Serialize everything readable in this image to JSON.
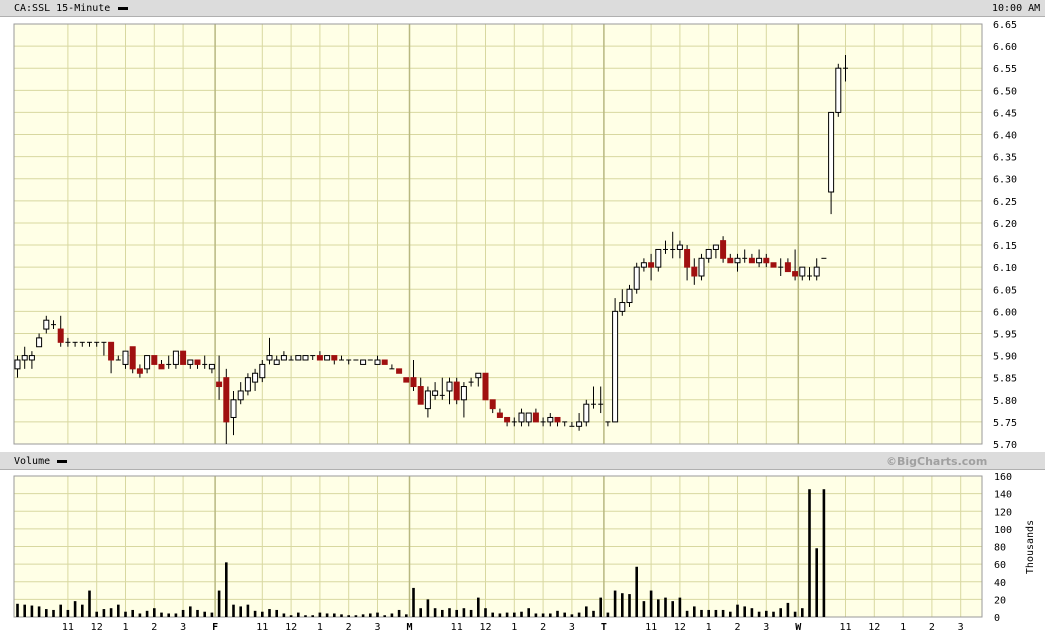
{
  "header": {
    "symbol_label": "CA:SSL 15-Minute",
    "time_label": "10:00 AM"
  },
  "volume_header": {
    "label": "Volume",
    "credit": "©BigCharts.com"
  },
  "colors": {
    "background": "#ffffe6",
    "grid": "#d8d8a0",
    "up": "#ffffff",
    "down": "#a01010",
    "outline": "#000000",
    "header_bg": "#dcdcdc"
  },
  "chart_data": [
    {
      "type": "candlestick",
      "name": "price",
      "ylim": [
        5.7,
        6.65
      ],
      "y_ticks": [
        "5.70",
        "5.75",
        "5.80",
        "5.85",
        "5.90",
        "5.95",
        "6.00",
        "6.05",
        "6.10",
        "6.15",
        "6.20",
        "6.25",
        "6.30",
        "6.35",
        "6.40",
        "6.45",
        "6.50",
        "6.55",
        "6.60",
        "6.65"
      ],
      "x_ticks": [
        {
          "label": "11",
          "bar": 7
        },
        {
          "label": "12",
          "bar": 11
        },
        {
          "label": "1",
          "bar": 15
        },
        {
          "label": "2",
          "bar": 19
        },
        {
          "label": "3",
          "bar": 23
        },
        {
          "label": "F",
          "bar": 28
        },
        {
          "label": "11",
          "bar": 34
        },
        {
          "label": "12",
          "bar": 38
        },
        {
          "label": "1",
          "bar": 42
        },
        {
          "label": "2",
          "bar": 46
        },
        {
          "label": "3",
          "bar": 50
        },
        {
          "label": "M",
          "bar": 55
        },
        {
          "label": "11",
          "bar": 61
        },
        {
          "label": "12",
          "bar": 65
        },
        {
          "label": "1",
          "bar": 69
        },
        {
          "label": "2",
          "bar": 73
        },
        {
          "label": "3",
          "bar": 77
        },
        {
          "label": "T",
          "bar": 82
        },
        {
          "label": "11",
          "bar": 88
        },
        {
          "label": "12",
          "bar": 92
        },
        {
          "label": "1",
          "bar": 96
        },
        {
          "label": "2",
          "bar": 100
        },
        {
          "label": "3",
          "bar": 104
        },
        {
          "label": "W",
          "bar": 109
        },
        {
          "label": "11",
          "bar": 115
        },
        {
          "label": "12",
          "bar": 119
        },
        {
          "label": "1",
          "bar": 123
        },
        {
          "label": "2",
          "bar": 127
        },
        {
          "label": "3",
          "bar": 131
        }
      ],
      "day_start_bars": [
        1,
        28,
        55,
        82,
        109
      ],
      "bars": [
        [
          5.87,
          5.9,
          5.85,
          5.89
        ],
        [
          5.89,
          5.92,
          5.87,
          5.9
        ],
        [
          5.89,
          5.91,
          5.87,
          5.9
        ],
        [
          5.92,
          5.95,
          5.92,
          5.94
        ],
        [
          5.96,
          5.99,
          5.95,
          5.98
        ],
        [
          5.97,
          5.98,
          5.96,
          5.97
        ],
        [
          5.96,
          5.99,
          5.92,
          5.93
        ],
        [
          5.93,
          5.94,
          5.92,
          5.93
        ],
        [
          5.93,
          5.93,
          5.92,
          5.93
        ],
        [
          5.93,
          5.93,
          5.92,
          5.93
        ],
        [
          5.93,
          5.93,
          5.92,
          5.93
        ],
        [
          5.93,
          5.93,
          5.92,
          5.93
        ],
        [
          5.93,
          5.93,
          5.9,
          5.93
        ],
        [
          5.93,
          5.93,
          5.86,
          5.89
        ],
        [
          5.89,
          5.9,
          5.89,
          5.89
        ],
        [
          5.88,
          5.91,
          5.87,
          5.91
        ],
        [
          5.92,
          5.92,
          5.86,
          5.87
        ],
        [
          5.87,
          5.88,
          5.85,
          5.86
        ],
        [
          5.87,
          5.9,
          5.86,
          5.9
        ],
        [
          5.9,
          5.9,
          5.88,
          5.88
        ],
        [
          5.88,
          5.89,
          5.87,
          5.87
        ],
        [
          5.88,
          5.9,
          5.87,
          5.88
        ],
        [
          5.88,
          5.91,
          5.87,
          5.91
        ],
        [
          5.91,
          5.91,
          5.88,
          5.88
        ],
        [
          5.88,
          5.89,
          5.87,
          5.89
        ],
        [
          5.89,
          5.89,
          5.87,
          5.88
        ],
        [
          5.88,
          5.9,
          5.87,
          5.88
        ],
        [
          5.87,
          5.88,
          5.86,
          5.88
        ],
        [
          5.84,
          5.9,
          5.8,
          5.83
        ],
        [
          5.85,
          5.87,
          5.7,
          5.75
        ],
        [
          5.76,
          5.82,
          5.72,
          5.8
        ],
        [
          5.8,
          5.84,
          5.79,
          5.82
        ],
        [
          5.82,
          5.86,
          5.81,
          5.85
        ],
        [
          5.84,
          5.87,
          5.82,
          5.86
        ],
        [
          5.85,
          5.89,
          5.84,
          5.88
        ],
        [
          5.89,
          5.94,
          5.88,
          5.9
        ],
        [
          5.88,
          5.9,
          5.88,
          5.89
        ],
        [
          5.89,
          5.91,
          5.89,
          5.9
        ],
        [
          5.89,
          5.9,
          5.89,
          5.89
        ],
        [
          5.89,
          5.9,
          5.89,
          5.9
        ],
        [
          5.89,
          5.9,
          5.89,
          5.9
        ],
        [
          5.9,
          5.9,
          5.89,
          5.9
        ],
        [
          5.9,
          5.91,
          5.89,
          5.89
        ],
        [
          5.89,
          5.9,
          5.89,
          5.9
        ],
        [
          5.9,
          5.9,
          5.88,
          5.89
        ],
        [
          5.89,
          5.9,
          5.89,
          5.89
        ],
        [
          5.89,
          5.89,
          5.88,
          5.89
        ],
        [
          5.89,
          5.89,
          5.89,
          5.89
        ],
        [
          5.88,
          5.89,
          5.88,
          5.89
        ],
        [
          5.89,
          5.89,
          5.89,
          5.89
        ],
        [
          5.88,
          5.9,
          5.88,
          5.89
        ],
        [
          5.89,
          5.89,
          5.88,
          5.88
        ],
        [
          5.87,
          5.88,
          5.87,
          5.87
        ],
        [
          5.87,
          5.87,
          5.86,
          5.86
        ],
        [
          5.85,
          5.85,
          5.84,
          5.84
        ],
        [
          5.85,
          5.89,
          5.82,
          5.83
        ],
        [
          5.83,
          5.85,
          5.79,
          5.79
        ],
        [
          5.78,
          5.83,
          5.76,
          5.82
        ],
        [
          5.81,
          5.84,
          5.8,
          5.82
        ],
        [
          5.81,
          5.85,
          5.8,
          5.81
        ],
        [
          5.82,
          5.85,
          5.79,
          5.84
        ],
        [
          5.84,
          5.85,
          5.79,
          5.8
        ],
        [
          5.8,
          5.84,
          5.76,
          5.83
        ],
        [
          5.84,
          5.85,
          5.83,
          5.84
        ],
        [
          5.85,
          5.86,
          5.83,
          5.86
        ],
        [
          5.86,
          5.86,
          5.8,
          5.8
        ],
        [
          5.8,
          5.8,
          5.77,
          5.78
        ],
        [
          5.77,
          5.78,
          5.76,
          5.76
        ],
        [
          5.76,
          5.76,
          5.74,
          5.75
        ],
        [
          5.75,
          5.76,
          5.74,
          5.75
        ],
        [
          5.75,
          5.78,
          5.74,
          5.77
        ],
        [
          5.75,
          5.77,
          5.74,
          5.77
        ],
        [
          5.77,
          5.78,
          5.75,
          5.75
        ],
        [
          5.75,
          5.76,
          5.74,
          5.75
        ],
        [
          5.75,
          5.77,
          5.74,
          5.76
        ],
        [
          5.76,
          5.76,
          5.74,
          5.75
        ],
        [
          5.75,
          5.75,
          5.74,
          5.75
        ],
        [
          5.74,
          5.75,
          5.74,
          5.74
        ],
        [
          5.74,
          5.77,
          5.73,
          5.75
        ],
        [
          5.75,
          5.8,
          5.74,
          5.79
        ],
        [
          5.79,
          5.83,
          5.78,
          5.79
        ],
        [
          5.79,
          5.83,
          5.77,
          5.79
        ],
        [
          5.75,
          5.75,
          5.74,
          5.75
        ],
        [
          5.75,
          6.03,
          5.75,
          6.0
        ],
        [
          6.0,
          6.05,
          5.99,
          6.02
        ],
        [
          6.02,
          6.06,
          6.01,
          6.05
        ],
        [
          6.05,
          6.11,
          6.04,
          6.1
        ],
        [
          6.1,
          6.12,
          6.09,
          6.11
        ],
        [
          6.11,
          6.13,
          6.07,
          6.1
        ],
        [
          6.1,
          6.14,
          6.09,
          6.14
        ],
        [
          6.14,
          6.16,
          6.13,
          6.14
        ],
        [
          6.14,
          6.18,
          6.12,
          6.14
        ],
        [
          6.14,
          6.16,
          6.12,
          6.15
        ],
        [
          6.14,
          6.15,
          6.07,
          6.1
        ],
        [
          6.1,
          6.12,
          6.06,
          6.08
        ],
        [
          6.08,
          6.13,
          6.07,
          6.12
        ],
        [
          6.12,
          6.14,
          6.11,
          6.14
        ],
        [
          6.14,
          6.15,
          6.12,
          6.15
        ],
        [
          6.16,
          6.17,
          6.11,
          6.12
        ],
        [
          6.12,
          6.13,
          6.11,
          6.11
        ],
        [
          6.11,
          6.13,
          6.09,
          6.12
        ],
        [
          6.12,
          6.14,
          6.11,
          6.12
        ],
        [
          6.12,
          6.13,
          6.11,
          6.11
        ],
        [
          6.11,
          6.14,
          6.1,
          6.12
        ],
        [
          6.12,
          6.13,
          6.1,
          6.11
        ],
        [
          6.11,
          6.11,
          6.1,
          6.1
        ],
        [
          6.1,
          6.12,
          6.08,
          6.1
        ],
        [
          6.11,
          6.12,
          6.09,
          6.09
        ],
        [
          6.09,
          6.14,
          6.07,
          6.08
        ],
        [
          6.08,
          6.1,
          6.07,
          6.1
        ],
        [
          6.08,
          6.1,
          6.07,
          6.08
        ],
        [
          6.08,
          6.12,
          6.07,
          6.1
        ],
        [
          6.12,
          6.12,
          6.12,
          6.12
        ],
        [
          6.27,
          6.45,
          6.22,
          6.45
        ],
        [
          6.45,
          6.56,
          6.44,
          6.55
        ],
        [
          6.55,
          6.58,
          6.52,
          6.55
        ]
      ]
    },
    {
      "type": "bar",
      "name": "volume",
      "ylabel": "Thousands",
      "ylim": [
        0,
        160
      ],
      "y_ticks": [
        "0",
        "20",
        "40",
        "60",
        "80",
        "100",
        "120",
        "140",
        "160"
      ],
      "values": [
        15,
        14,
        13,
        12,
        9,
        8,
        14,
        8,
        18,
        14,
        30,
        6,
        9,
        10,
        14,
        6,
        8,
        4,
        7,
        10,
        5,
        4,
        4,
        8,
        12,
        8,
        6,
        5,
        30,
        62,
        14,
        12,
        14,
        7,
        6,
        9,
        8,
        4,
        2,
        5,
        2,
        2,
        5,
        4,
        4,
        3,
        2,
        2,
        3,
        4,
        5,
        2,
        4,
        8,
        3,
        33,
        10,
        20,
        10,
        8,
        10,
        8,
        10,
        8,
        22,
        10,
        5,
        4,
        5,
        5,
        6,
        10,
        4,
        4,
        4,
        7,
        5,
        3,
        5,
        12,
        7,
        22,
        5,
        30,
        27,
        26,
        57,
        18,
        30,
        20,
        22,
        18,
        22,
        7,
        12,
        8,
        8,
        8,
        8,
        6,
        14,
        12,
        10,
        6,
        7,
        6,
        10,
        16,
        6,
        10,
        145,
        78,
        145
      ]
    }
  ]
}
